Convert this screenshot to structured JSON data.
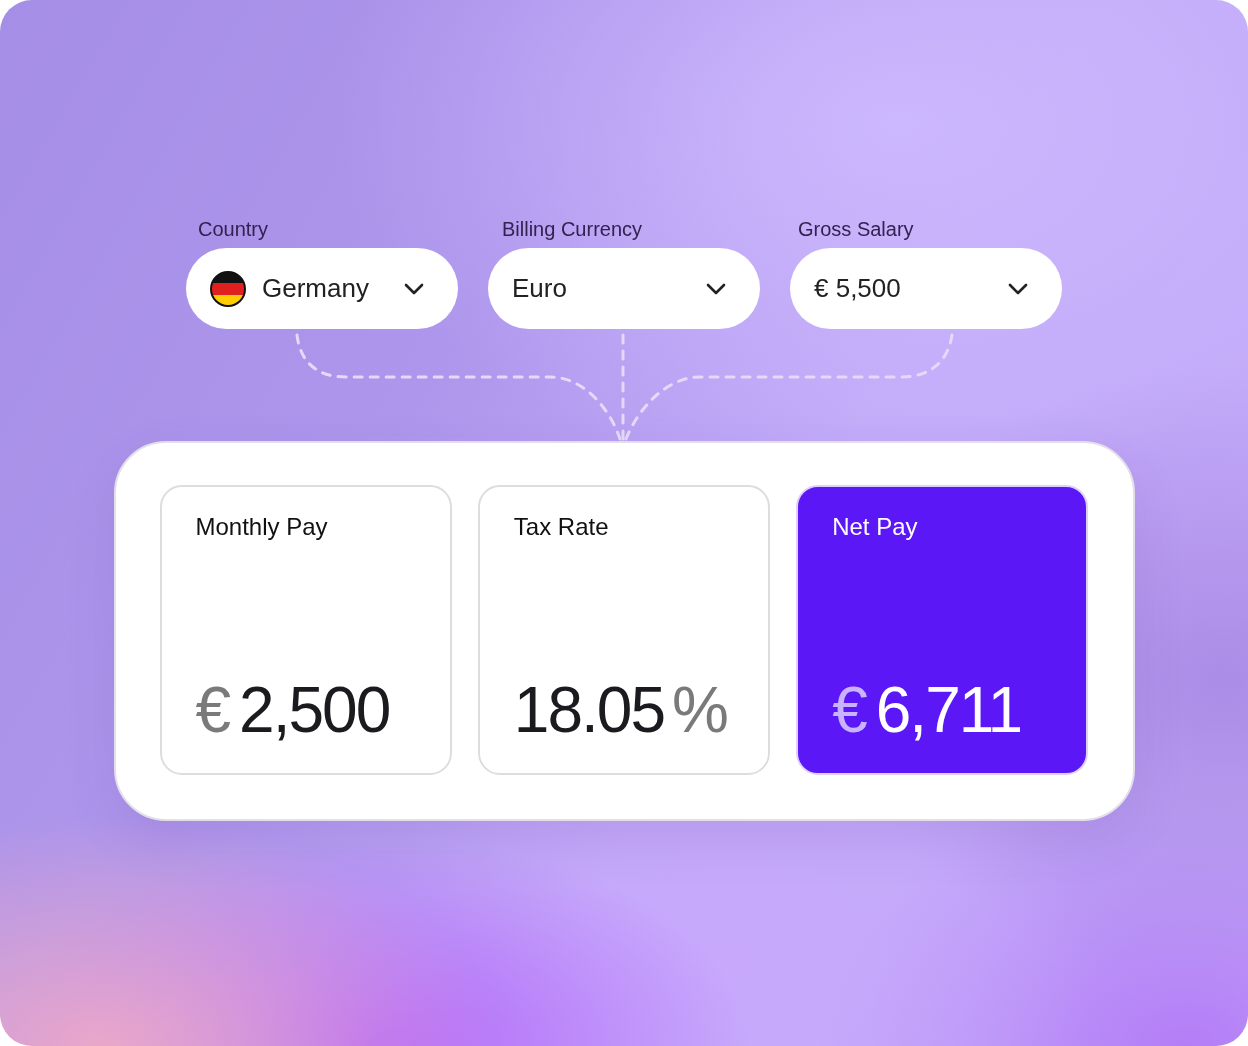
{
  "fields": [
    {
      "label": "Country",
      "value": "Germany",
      "kind": "flag"
    },
    {
      "label": "Billing Currency",
      "value": "Euro",
      "kind": "plain"
    },
    {
      "label": "Gross Salary",
      "value": "€ 5,500",
      "kind": "plain"
    }
  ],
  "results": [
    {
      "title": "Monthly Pay",
      "prefix": "€",
      "amount": "2,500",
      "highlighted": false
    },
    {
      "title": "Tax Rate",
      "amount": "18.05",
      "suffix": "%",
      "highlighted": false
    },
    {
      "title": "Net Pay",
      "prefix": "€",
      "amount": "6,711",
      "highlighted": true
    }
  ]
}
